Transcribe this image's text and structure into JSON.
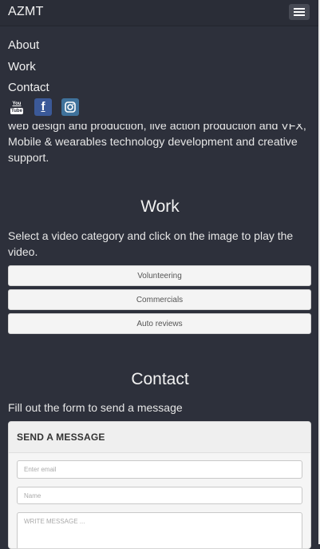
{
  "navbar": {
    "brand": "AZMT",
    "toggle_icon": "hamburger-menu-icon"
  },
  "menu": {
    "items": [
      "About",
      "Work",
      "Contact"
    ]
  },
  "social": {
    "items": [
      {
        "icon": "youtube-icon",
        "label": "You Tube",
        "color": "#2d303b"
      },
      {
        "icon": "facebook-icon",
        "label": "f",
        "color": "#3b5998"
      },
      {
        "icon": "instagram-icon",
        "label": "◎",
        "color": "#3f729b"
      }
    ]
  },
  "intro": {
    "text": "web design and production, live action production and VFX, Mobile & wearables technology development and creative support."
  },
  "work": {
    "title": "Work",
    "lead": "Select a video category and click on the image to play the video.",
    "categories": [
      "Volunteering",
      "Commercials",
      "Auto reviews"
    ]
  },
  "contact": {
    "title": "Contact",
    "lead": "Fill out the form to send a message",
    "panel_title": "SEND A MESSAGE",
    "email_placeholder": "Enter email",
    "name_placeholder": "Name",
    "message_placeholder": "WRITE MESSAGE ..."
  }
}
